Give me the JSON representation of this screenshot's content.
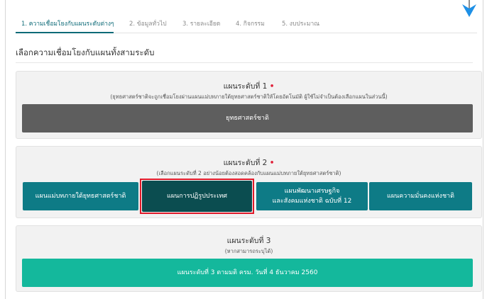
{
  "tabs": [
    {
      "label": "1. ความเชื่อมโยงกับแผนระดับต่างๆ",
      "active": true
    },
    {
      "label": "2. ข้อมูลทั่วไป",
      "active": false
    },
    {
      "label": "3. รายละเอียด",
      "active": false
    },
    {
      "label": "4. กิจกรรม",
      "active": false
    },
    {
      "label": "5. งบประมาณ",
      "active": false
    }
  ],
  "section_title": "เลือกความเชื่อมโยงกับแผนทั้งสามระดับ",
  "level1": {
    "title": "แผนระดับที่ 1",
    "required_mark": "•",
    "note": "(ยุทธศาสตร์ชาติจะถูกเชื่อมโยงผ่านแผนแม่บทภายใต้ยุทธศาสตร์ชาติให้โดยอัตโนมัติ ผู้ใช้ไม่จำเป็นต้องเลือกแผนในส่วนนี้)",
    "button": "ยุทธศาสตร์ชาติ"
  },
  "level2": {
    "title": "แผนระดับที่ 2",
    "required_mark": "•",
    "note": "(เลือกแผนระดับที่ 2 อย่างน้อยต้องสอดคล้องกับแผนแม่บทภายใต้ยุทธศาสตร์ชาติ)",
    "buttons": [
      "แผนแม่บทภายใต้ยุทธศาสตร์ชาติ",
      "แผนการปฏิรูปประเทศ",
      "แผนพัฒนาเศรษฐกิจ\nและสังคมแห่งชาติ ฉบับที่ 12",
      "แผนความมั่นคงแห่งชาติ"
    ],
    "selected_index": 1
  },
  "level3": {
    "title": "แผนระดับที่ 3",
    "note": "(หากสามารถระบุได้)",
    "button": "แผนระดับที่ 3 ตามมติ ครม. วันที่ 4 ธันวาคม 2560"
  },
  "colors": {
    "accent": "#0e6b78",
    "teal_button": "#0e7b86",
    "selected_button": "#0b4d50",
    "grey_button": "#5e5e5e",
    "mint_button": "#14b89c",
    "required": "#e0213a",
    "highlight": "#e11a2a",
    "arrow": "#1e90e6"
  },
  "icons": {
    "corner": "arrow-down-icon"
  }
}
